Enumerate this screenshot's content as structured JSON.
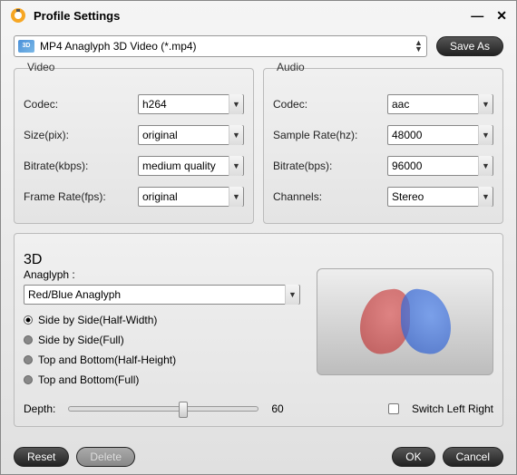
{
  "window": {
    "title": "Profile Settings"
  },
  "profile": {
    "selected": "MP4 Anaglyph 3D Video (*.mp4)",
    "icon_badge": "3D"
  },
  "buttons": {
    "save_as": "Save As",
    "reset": "Reset",
    "delete": "Delete",
    "ok": "OK",
    "cancel": "Cancel"
  },
  "video": {
    "legend": "Video",
    "codec": {
      "label": "Codec:",
      "value": "h264"
    },
    "size": {
      "label": "Size(pix):",
      "value": "original"
    },
    "bitrate": {
      "label": "Bitrate(kbps):",
      "value": "medium quality"
    },
    "frame_rate": {
      "label": "Frame Rate(fps):",
      "value": "original"
    }
  },
  "audio": {
    "legend": "Audio",
    "codec": {
      "label": "Codec:",
      "value": "aac"
    },
    "sample_rate": {
      "label": "Sample Rate(hz):",
      "value": "48000"
    },
    "bitrate": {
      "label": "Bitrate(bps):",
      "value": "96000"
    },
    "channels": {
      "label": "Channels:",
      "value": "Stereo"
    }
  },
  "three_d": {
    "legend": "3D",
    "anaglyph_label": "Anaglyph :",
    "anaglyph_value": "Red/Blue Anaglyph",
    "options": {
      "sbs_half": "Side by Side(Half-Width)",
      "sbs_full": "Side by Side(Full)",
      "tb_half": "Top and Bottom(Half-Height)",
      "tb_full": "Top and Bottom(Full)"
    },
    "depth_label": "Depth:",
    "depth_value": "60",
    "switch_label": "Switch Left Right"
  }
}
